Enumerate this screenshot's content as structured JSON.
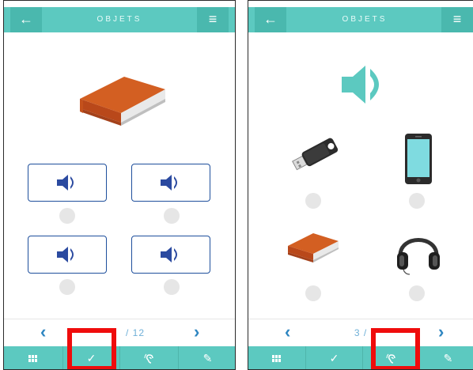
{
  "left": {
    "header": {
      "back_icon": "←",
      "title": "OBJETS",
      "menu_icon": "≡"
    },
    "question": {
      "image": "book-icon"
    },
    "answers": [
      {
        "icon": "speaker-icon"
      },
      {
        "icon": "speaker-icon"
      },
      {
        "icon": "speaker-icon"
      },
      {
        "icon": "speaker-icon"
      }
    ],
    "pager": {
      "prev": "‹",
      "count": "/ 12",
      "next": "›"
    },
    "tabs": [
      {
        "name": "grid",
        "icon": "▦"
      },
      {
        "name": "check",
        "icon": "✓"
      },
      {
        "name": "listen",
        "icon": "ear-icon"
      },
      {
        "name": "edit",
        "icon": "✎"
      }
    ]
  },
  "right": {
    "header": {
      "back_icon": "←",
      "title": "OBJETS",
      "menu_icon": "≡"
    },
    "question": {
      "icon": "speaker-icon"
    },
    "answers": [
      {
        "image": "usb-drive-icon"
      },
      {
        "image": "smartphone-icon"
      },
      {
        "image": "book-icon"
      },
      {
        "image": "headphones-icon"
      }
    ],
    "pager": {
      "prev": "‹",
      "count": "3 /",
      "next": "›"
    },
    "tabs": [
      {
        "name": "grid",
        "icon": "▦"
      },
      {
        "name": "check",
        "icon": "✓"
      },
      {
        "name": "listen",
        "icon": "ear-icon"
      },
      {
        "name": "edit",
        "icon": "✎"
      }
    ]
  },
  "colors": {
    "teal": "#5cc9c0",
    "teal_dark": "#4ab8ae",
    "navy_icon": "#2b4aa0",
    "highlight_red": "#ef0c0c",
    "book_orange": "#c8561e"
  }
}
